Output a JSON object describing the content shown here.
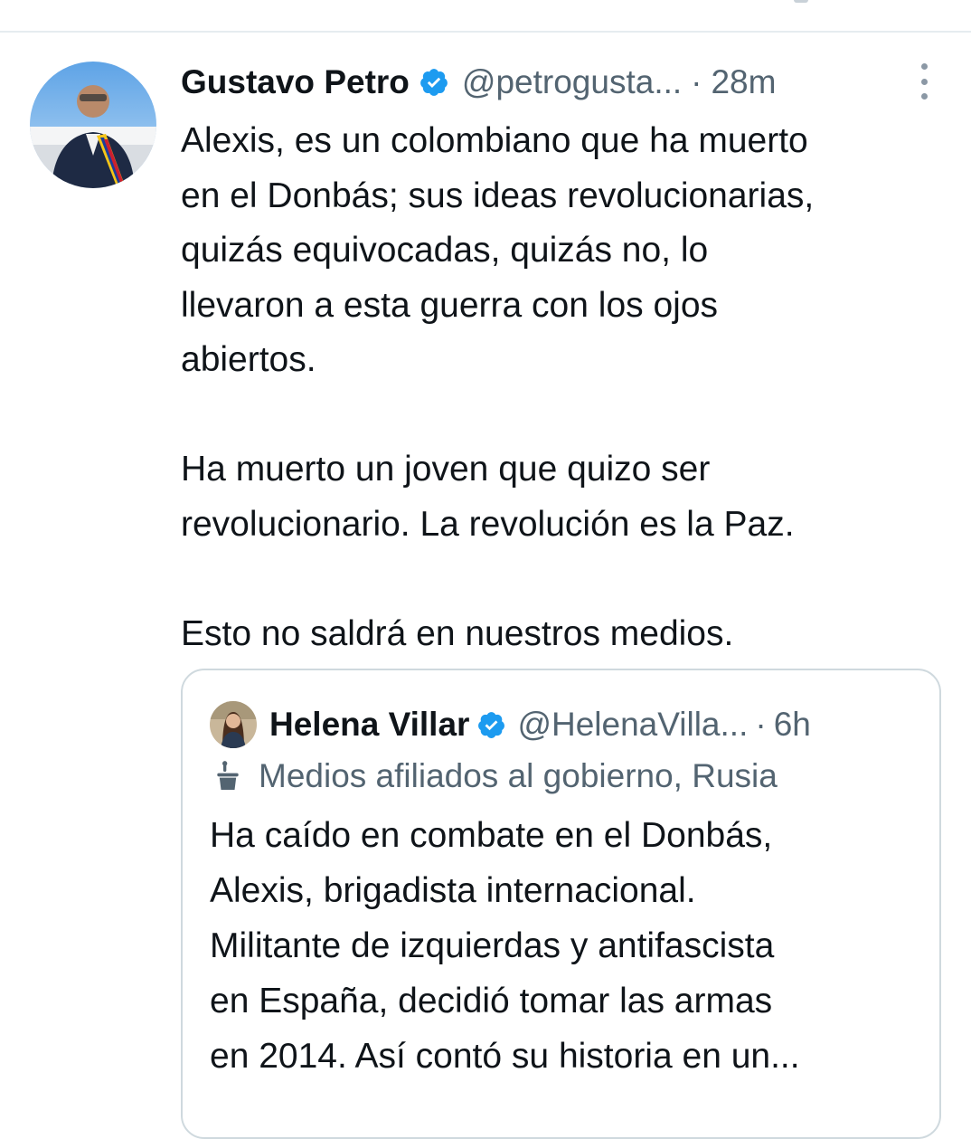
{
  "tweet": {
    "author_name": "Gustavo Petro",
    "author_handle": "@petrogusta...",
    "separator": "·",
    "time": "28m",
    "verified_icon": "verified-badge-icon",
    "more_icon": "more-vertical-icon",
    "lines": [
      "Alexis, es un colombiano que ha muerto",
      "en el Donbás; sus ideas revolucionarias,",
      "quizás equivocadas, quizás no, lo",
      "llevaron a esta guerra con los ojos",
      "abiertos.",
      "",
      "Ha muerto un joven que quizo ser",
      "revolucionario. La revolución es la Paz.",
      "",
      "Esto no saldrá en nuestros medios."
    ]
  },
  "quoted_tweet": {
    "author_name": "Helena Villar",
    "author_handle": "@HelenaVilla...",
    "separator": "·",
    "time": "6h",
    "affiliation_label": "Medios afiliados al gobierno, Rusia",
    "affiliation_icon": "state-media-podium-icon",
    "lines": [
      "Ha caído en combate en el Donbás,",
      "Alexis, brigadista internacional.",
      "Militante de izquierdas y antifascista",
      "en España, decidió tomar las armas",
      "en 2014. Así contó su historia en un..."
    ]
  },
  "colors": {
    "verified_blue": "#1d9bf0",
    "secondary_text": "#536471",
    "border": "#cfd9de"
  }
}
